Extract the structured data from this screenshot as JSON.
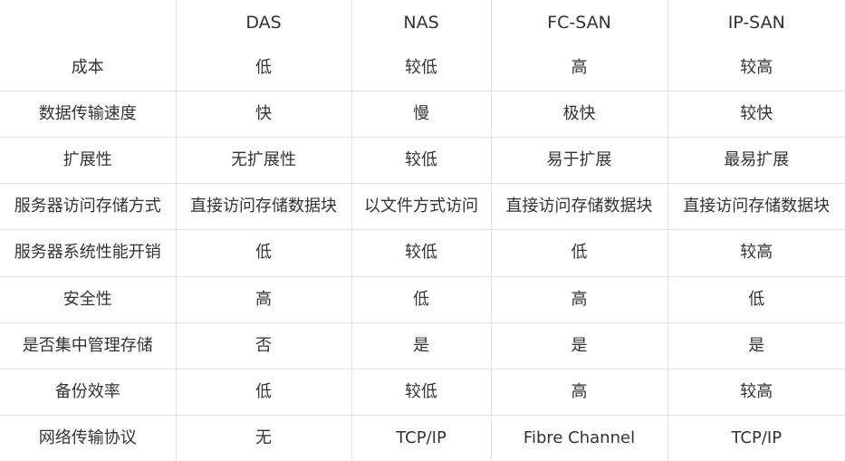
{
  "table": {
    "headers": [
      "",
      "DAS",
      "NAS",
      "FC-SAN",
      "IP-SAN"
    ],
    "rows": [
      [
        "成本",
        "低",
        "较低",
        "高",
        "较高"
      ],
      [
        "数据传输速度",
        "快",
        "慢",
        "极快",
        "较快"
      ],
      [
        "扩展性",
        "无扩展性",
        "较低",
        "易于扩展",
        "最易扩展"
      ],
      [
        "服务器访问存储方式",
        "直接访问存储数据块",
        "以文件方式访问",
        "直接访问存储数据块",
        "直接访问存储数据块"
      ],
      [
        "服务器系统性能开销",
        "低",
        "较低",
        "低",
        "较高"
      ],
      [
        "安全性",
        "高",
        "低",
        "高",
        "低"
      ],
      [
        "是否集中管理存储",
        "否",
        "是",
        "是",
        "是"
      ],
      [
        "备份效率",
        "低",
        "较低",
        "高",
        "较高"
      ],
      [
        "网络传输协议",
        "无",
        "TCP/IP",
        "Fibre Channel",
        "TCP/IP"
      ]
    ]
  },
  "colors": {
    "border": "#e3e3e3",
    "text": "#333333",
    "background": "#ffffff"
  }
}
